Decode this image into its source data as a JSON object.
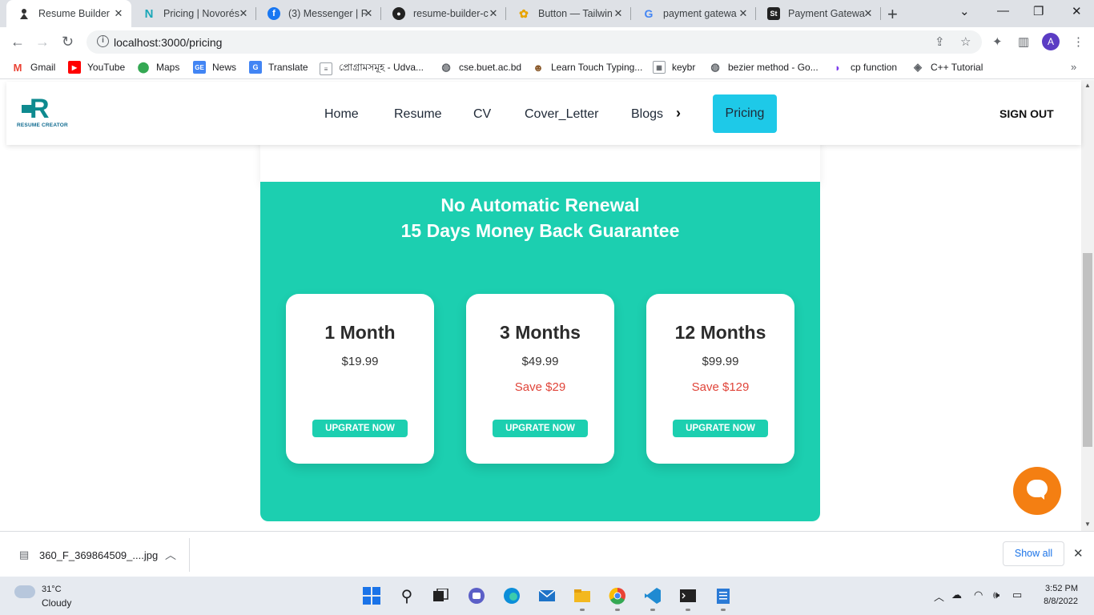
{
  "browser": {
    "tabs": [
      {
        "title": "Resume Builder",
        "favicon": "person-icon",
        "active": true
      },
      {
        "title": "Pricing | Novorés",
        "favicon": "novoresume-icon"
      },
      {
        "title": "(3) Messenger | F",
        "favicon": "facebook-icon"
      },
      {
        "title": "resume-builder-c",
        "favicon": "github-icon"
      },
      {
        "title": "Button — Tailwin",
        "favicon": "flower-icon"
      },
      {
        "title": "payment gatewa",
        "favicon": "google-icon"
      },
      {
        "title": "Payment Gatewa",
        "favicon": "st-icon"
      }
    ],
    "url": "localhost:3000/pricing",
    "profile_initial": "A",
    "bookmarks": [
      {
        "label": "Gmail",
        "icon": "gmail-icon"
      },
      {
        "label": "YouTube",
        "icon": "youtube-icon"
      },
      {
        "label": "Maps",
        "icon": "maps-icon"
      },
      {
        "label": "News",
        "icon": "news-icon"
      },
      {
        "label": "Translate",
        "icon": "translate-icon"
      },
      {
        "label": "প্রোগ্রামসমূহ - Udva...",
        "icon": "doc-icon"
      },
      {
        "label": "cse.buet.ac.bd",
        "icon": "globe-icon"
      },
      {
        "label": "Learn Touch Typing...",
        "icon": "typing-icon"
      },
      {
        "label": "keybr",
        "icon": "keybr-icon"
      },
      {
        "label": "bezier method - Go...",
        "icon": "globe-icon"
      },
      {
        "label": "cp function",
        "icon": "cp-icon"
      },
      {
        "label": "C++ Tutorial",
        "icon": "cpp-icon"
      }
    ]
  },
  "site": {
    "logo_text": "RESUME CREATOR",
    "logo_letter": "R",
    "nav": [
      "Home",
      "Resume",
      "CV",
      "Cover_Letter",
      "Blogs"
    ],
    "pricing_label": "Pricing",
    "signout_label": "SIGN OUT"
  },
  "pricing": {
    "headline1": "No Automatic Renewal",
    "headline2": "15 Days Money Back Guarantee",
    "plans": [
      {
        "name": "1 Month",
        "price": "$19.99",
        "save": "",
        "cta": "UPGRATE NOW"
      },
      {
        "name": "3 Months",
        "price": "$49.99",
        "save": "Save $29",
        "cta": "UPGRATE NOW"
      },
      {
        "name": "12 Months",
        "price": "$99.99",
        "save": "Save $129",
        "cta": "UPGRATE NOW"
      }
    ]
  },
  "downloads": {
    "file": "360_F_369864509_....jpg",
    "show_all": "Show all"
  },
  "taskbar": {
    "temperature": "31°C",
    "weather": "Cloudy",
    "time": "3:52 PM",
    "date": "8/8/2022"
  },
  "colors": {
    "accent_green": "#1ccfb0",
    "pricing_button": "#1ec9e8",
    "save_red": "#e0453a",
    "chat_orange": "#f47f12"
  }
}
